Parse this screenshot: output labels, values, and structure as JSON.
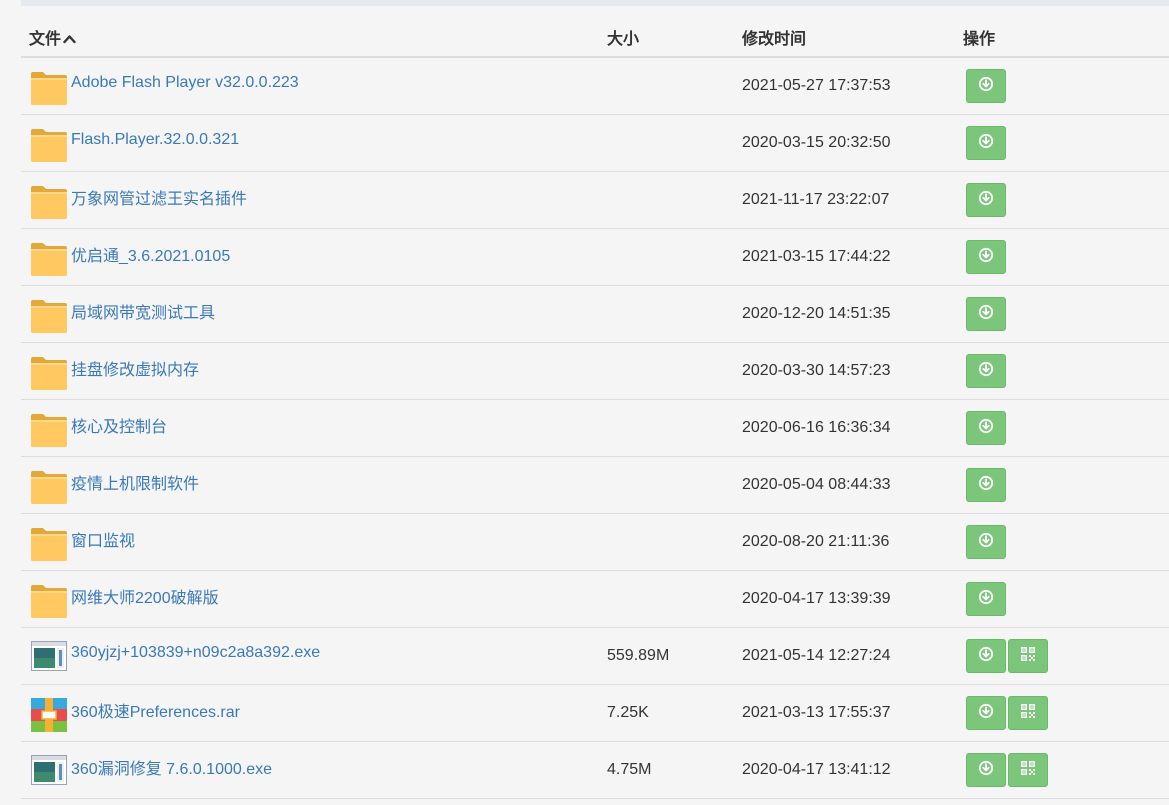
{
  "header": {
    "col_name": "文件",
    "col_size": "大小",
    "col_time": "修改时间",
    "col_ops": "操作"
  },
  "colors": {
    "link": "#3a79b8",
    "button_green": "#7cc67c",
    "folder": "#ffc861"
  },
  "rows": [
    {
      "name": "Adobe Flash Player v32.0.0.223",
      "size": "",
      "time": "2021-05-27 17:37:53",
      "icon": "folder-icon",
      "qrcode": false
    },
    {
      "name": "Flash.Player.32.0.0.321",
      "size": "",
      "time": "2020-03-15 20:32:50",
      "icon": "folder-icon",
      "qrcode": false
    },
    {
      "name": "万象网管过滤王实名插件",
      "size": "",
      "time": "2021-11-17 23:22:07",
      "icon": "folder-icon",
      "qrcode": false
    },
    {
      "name": "优启通_3.6.2021.0105",
      "size": "",
      "time": "2021-03-15 17:44:22",
      "icon": "folder-icon",
      "qrcode": false
    },
    {
      "name": "局域网带宽测试工具",
      "size": "",
      "time": "2020-12-20 14:51:35",
      "icon": "folder-icon",
      "qrcode": false
    },
    {
      "name": "挂盘修改虚拟内存",
      "size": "",
      "time": "2020-03-30 14:57:23",
      "icon": "folder-icon",
      "qrcode": false
    },
    {
      "name": "核心及控制台",
      "size": "",
      "time": "2020-06-16 16:36:34",
      "icon": "folder-icon",
      "qrcode": false
    },
    {
      "name": "疫情上机限制软件",
      "size": "",
      "time": "2020-05-04 08:44:33",
      "icon": "folder-icon",
      "qrcode": false
    },
    {
      "name": "窗口监视",
      "size": "",
      "time": "2020-08-20 21:11:36",
      "icon": "folder-icon",
      "qrcode": false
    },
    {
      "name": "网维大师2200破解版",
      "size": "",
      "time": "2020-04-17 13:39:39",
      "icon": "folder-icon",
      "qrcode": false
    },
    {
      "name": "360yjzj+103839+n09c2a8a392.exe",
      "size": "559.89M",
      "time": "2021-05-14 12:27:24",
      "icon": "exe-file-icon",
      "qrcode": true
    },
    {
      "name": "360极速Preferences.rar",
      "size": "7.25K",
      "time": "2021-03-13 17:55:37",
      "icon": "rar-archive-icon",
      "qrcode": true
    },
    {
      "name": "360漏洞修复 7.6.0.1000.exe",
      "size": "4.75M",
      "time": "2020-04-17 13:41:12",
      "icon": "exe-file-icon",
      "qrcode": true
    }
  ]
}
